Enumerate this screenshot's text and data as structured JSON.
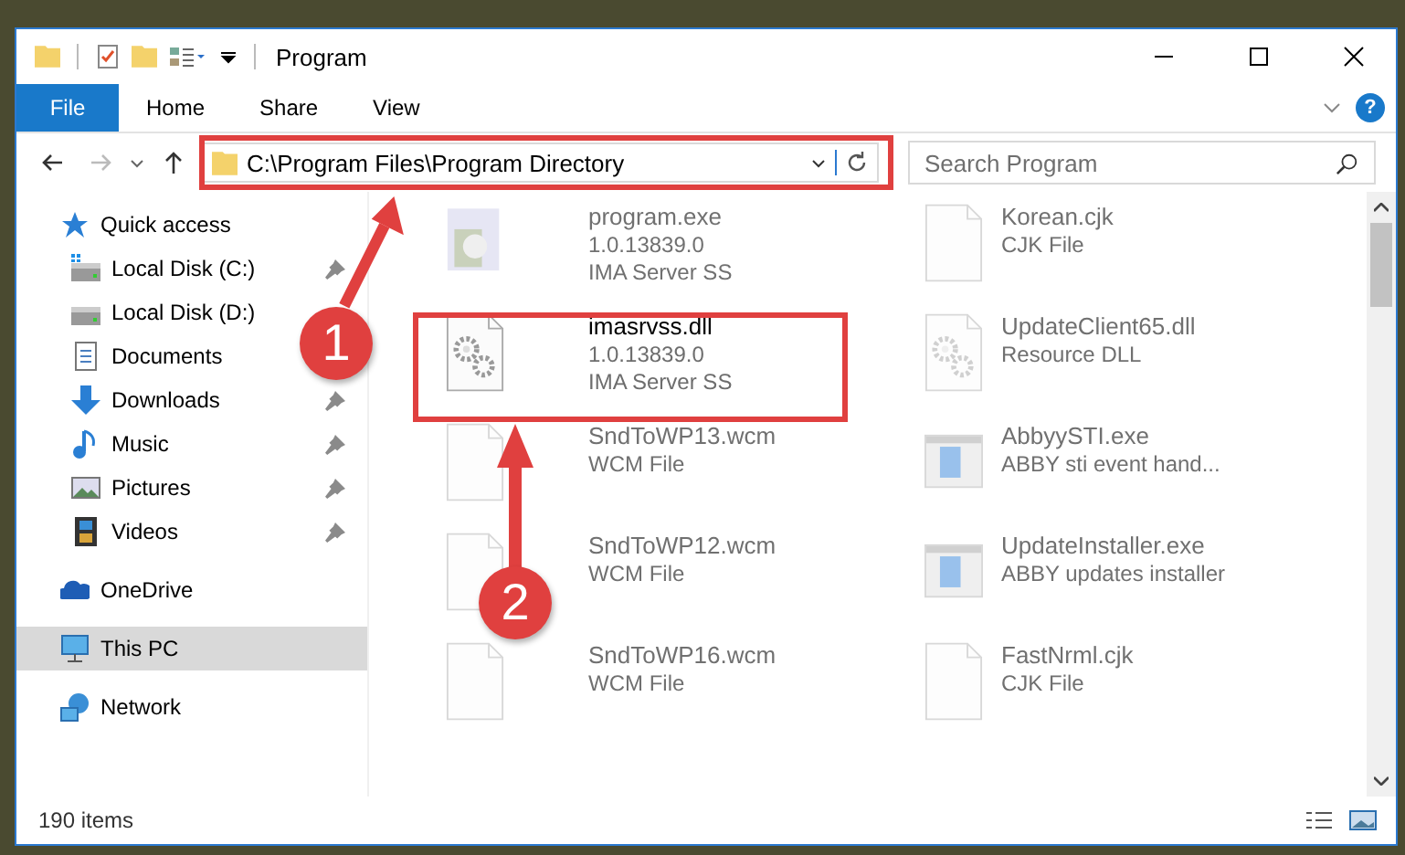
{
  "window": {
    "title": "Program"
  },
  "ribbon": {
    "tabs": [
      {
        "label": "File",
        "kind": "file",
        "selected": false
      },
      {
        "label": "Home",
        "kind": "tab",
        "selected": false
      },
      {
        "label": "Share",
        "kind": "tab",
        "selected": false
      },
      {
        "label": "View",
        "kind": "tab",
        "selected": false
      }
    ],
    "help": "?"
  },
  "address": {
    "path": "C:\\Program Files\\Program Directory"
  },
  "search": {
    "placeholder": "Search Program"
  },
  "navigation": [
    {
      "label": "Quick access",
      "kind": "star",
      "selected": false,
      "children": [
        {
          "label": "Local Disk (C:)",
          "kind": "drive-c",
          "pinned": true,
          "selected": false
        },
        {
          "label": "Local Disk (D:)",
          "kind": "drive",
          "pinned": false,
          "selected": false
        },
        {
          "label": "Documents",
          "kind": "documents",
          "pinned": false,
          "selected": false
        },
        {
          "label": "Downloads",
          "kind": "downloads",
          "pinned": true,
          "selected": false
        },
        {
          "label": "Music",
          "kind": "music",
          "pinned": true,
          "selected": false
        },
        {
          "label": "Pictures",
          "kind": "pictures",
          "pinned": true,
          "selected": false
        },
        {
          "label": "Videos",
          "kind": "videos",
          "pinned": true,
          "selected": false
        }
      ]
    },
    {
      "label": "OneDrive",
      "kind": "cloud",
      "selected": false
    },
    {
      "label": "This PC",
      "kind": "pc",
      "selected": true
    },
    {
      "label": "Network",
      "kind": "network",
      "selected": false
    }
  ],
  "files": [
    {
      "name": "program.exe",
      "lines": [
        "1.0.13839.0",
        "IMA Server SS"
      ],
      "kind": "app",
      "blurred": true
    },
    {
      "name": "Korean.cjk",
      "lines": [
        "CJK File"
      ],
      "kind": "blank",
      "blurred": true
    },
    {
      "name": "imasrvss.dll",
      "lines": [
        "1.0.13839.0",
        "IMA Server SS"
      ],
      "kind": "gears",
      "blurred": false
    },
    {
      "name": "UpdateClient65.dll",
      "lines": [
        "Resource DLL"
      ],
      "kind": "gears",
      "blurred": true
    },
    {
      "name": "SndToWP13.wcm",
      "lines": [
        "WCM File"
      ],
      "kind": "blank",
      "blurred": true
    },
    {
      "name": "AbbyySTI.exe",
      "lines": [
        "ABBY sti event hand..."
      ],
      "kind": "window",
      "blurred": true
    },
    {
      "name": "SndToWP12.wcm",
      "lines": [
        "WCM File"
      ],
      "kind": "blank",
      "blurred": true
    },
    {
      "name": "UpdateInstaller.exe",
      "lines": [
        "ABBY updates installer"
      ],
      "kind": "window",
      "blurred": true
    },
    {
      "name": "SndToWP16.wcm",
      "lines": [
        "WCM File"
      ],
      "kind": "blank",
      "blurred": true
    },
    {
      "name": "FastNrml.cjk",
      "lines": [
        "CJK File"
      ],
      "kind": "blank",
      "blurred": true
    }
  ],
  "status_bar": {
    "count": "190 items"
  },
  "annotations": [
    {
      "label": "1"
    },
    {
      "label": "2"
    }
  ]
}
